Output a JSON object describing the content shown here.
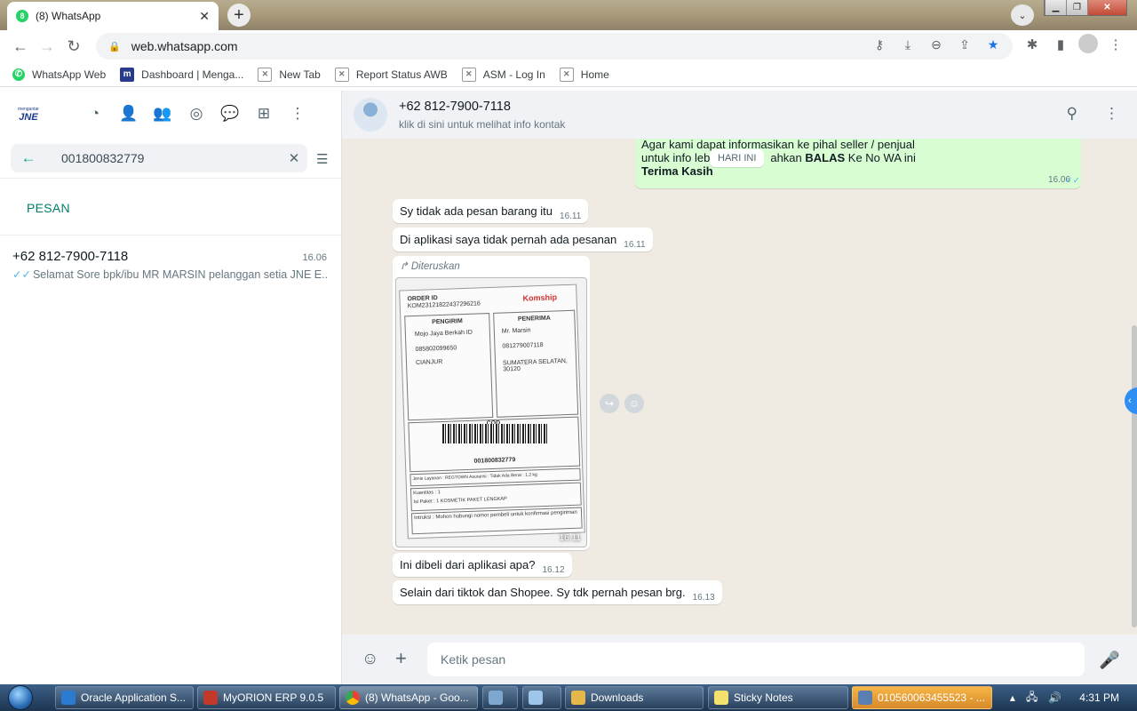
{
  "browser": {
    "tab_title": "(8) WhatsApp",
    "tab_favicon_text": "8",
    "url": "web.whatsapp.com",
    "bookmarks": [
      {
        "label": "WhatsApp Web",
        "icon": "whatsapp-icon"
      },
      {
        "label": "Dashboard | Menga...",
        "icon": "m-icon"
      },
      {
        "label": "New Tab",
        "icon": "generic-page-icon"
      },
      {
        "label": "Report Status AWB",
        "icon": "generic-page-icon"
      },
      {
        "label": "ASM - Log In",
        "icon": "generic-page-icon"
      },
      {
        "label": "Home",
        "icon": "generic-page-icon"
      }
    ],
    "accent": "#1a73e8"
  },
  "left": {
    "logo_top": "mengantar",
    "logo_main": "JNE",
    "search_value": "001800832779",
    "section_label": "PESAN",
    "result": {
      "name": "+62 812-7900-7118",
      "time": "16.06",
      "snippet": "Selamat Sore  bpk/ibu MR MARSIN pelanggan setia JNE E..."
    }
  },
  "chat": {
    "contact_name": "+62 812-7900-7118",
    "contact_sub": "klik di sini untuk melihat info kontak",
    "day_label": "HARI INI",
    "outgoing": {
      "line1": "Agar kami dapat informasikan ke pihal seller / penjual",
      "line2_a": "untuk info leb",
      "line2_b": "ahkan ",
      "line2_bold": "BALAS",
      "line2_c": " Ke No WA ini",
      "line3_bold": "Terima Kasih",
      "time": "16.06"
    },
    "messages": [
      {
        "text": "Sy tidak ada pesan barang itu",
        "time": "16.11"
      },
      {
        "text": "Di aplikasi saya tidak pernah ada pesanan",
        "time": "16.11"
      },
      {
        "text": "Ini dibeli dari aplikasi apa?",
        "time": "16.12"
      },
      {
        "text": "Selain dari tiktok dan Shopee. Sy tdk pernah pesan brg.",
        "time": "16.13"
      }
    ],
    "forwarded_label": "Diteruskan",
    "photo_time": "16.11",
    "photo_text": {
      "order": "ORDER ID",
      "order_no": "KOM23121822437296216",
      "brand": "Komship",
      "sender_label": "PENGIRIM",
      "sender_name": "Mojo Jaya Berkah ID",
      "sender_phone": "085802099650",
      "sender_city": "CIANJUR",
      "recv_label": "PENERIMA",
      "recv_name": "Mr. Marsin",
      "recv_phone": "081279007118",
      "recv_addr": "SUMATERA SELATAN, 30120",
      "cod_label": "COD",
      "cod_amount": "Rp140.000",
      "barcode_no": "001800832779",
      "row1": "Jenis Layanan : REGTOWN   Asuransi : Tidak Ada   Berat : 1,2 kg",
      "row2": "Kuantitas : 1",
      "row3": "Isi Paket : 1 KOSMETIK PAKET LENGKAP",
      "row4": "Intruksi : Mohon hubungi nomor pembeli untuk konfirmasi pengiriman"
    },
    "composer_placeholder": "Ketik pesan",
    "colors": {
      "outgoing": "#d9fdd3",
      "accent": "#00a884",
      "tick": "#53bdeb"
    }
  },
  "taskbar": {
    "items": [
      "Oracle Application S...",
      "MyORION ERP 9.0.5",
      "(8) WhatsApp - Goo...",
      "",
      "",
      "Downloads",
      "Sticky Notes",
      "010560063455523 - ..."
    ],
    "clock": "4:31 PM"
  }
}
